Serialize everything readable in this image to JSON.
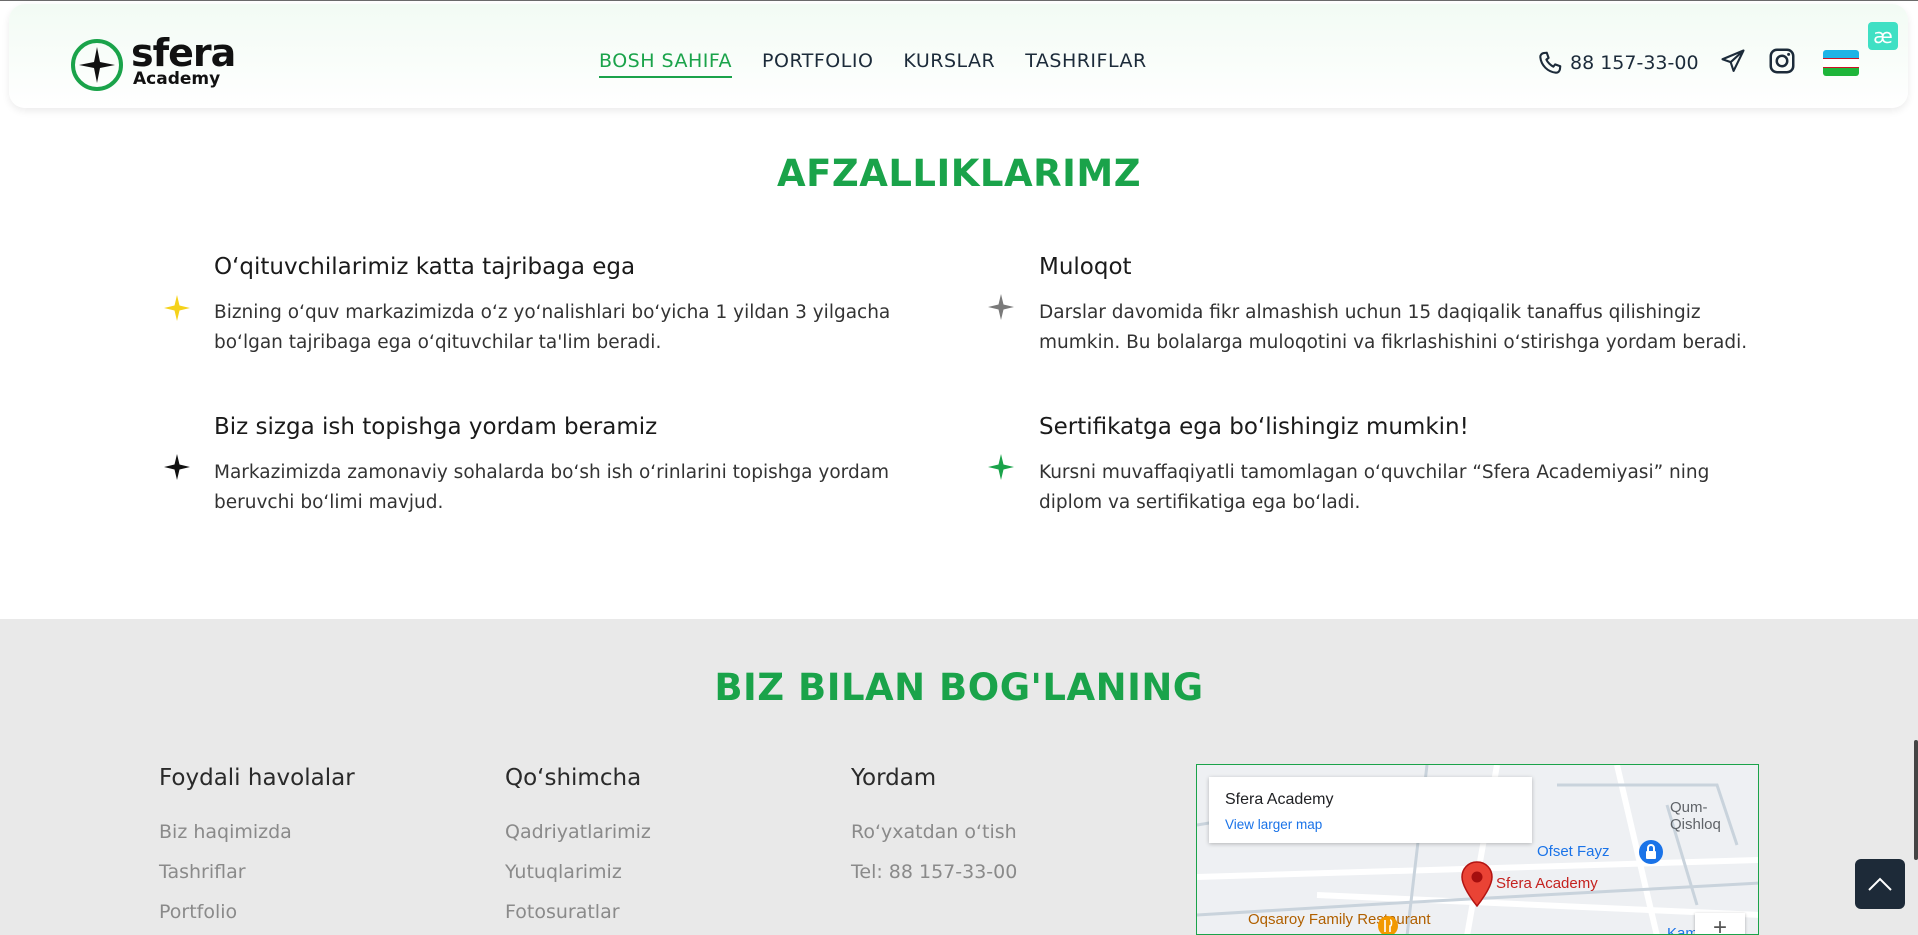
{
  "header": {
    "logo": {
      "name": "sfera",
      "sub": "Academy"
    },
    "nav": [
      {
        "label": "BOSH SAHIFA",
        "active": true
      },
      {
        "label": "PORTFOLIO",
        "active": false
      },
      {
        "label": "KURSLAR",
        "active": false
      },
      {
        "label": "TASHRIFLAR",
        "active": false
      }
    ],
    "phone": "88 157-33-00",
    "icons": [
      "phone-icon",
      "telegram-icon",
      "instagram-icon",
      "uzbekistan-flag-icon"
    ],
    "extension_badge": "æ"
  },
  "advantages": {
    "title": "AFZALLIKLARIMZ",
    "items": [
      {
        "title": "O‘qituvchilarimiz katta tajribaga ega",
        "text": "Bizning o‘quv markazimizda o‘z yo‘nalishlari bo‘yicha 1 yildan 3 yilgacha bo‘lgan tajribaga ega o‘qituvchilar ta'lim beradi.",
        "star_color": "#f5d21a"
      },
      {
        "title": "Muloqot",
        "text": "Darslar davomida fikr almashish uchun 15 daqiqalik tanaffus qilishingiz mumkin. Bu bolalarga muloqotini va fikrlashishini o‘stirishga yordam beradi.",
        "star_color": "#7a7a7a"
      },
      {
        "title": "Biz sizga ish topishga yordam beramiz",
        "text": "Markazimizda zamonaviy sohalarda bo‘sh ish o‘rinlarini topishga yordam beruvchi bo‘limi mavjud.",
        "star_color": "#111111"
      },
      {
        "title": "Sertifikatga ega bo‘lishingiz mumkin!",
        "text": "Kursni muvaffaqiyatli tamomlagan o‘quvchilar “Sfera Academiyasi” ning diplom va sertifikatiga ega bo‘ladi.",
        "star_color": "#1aa34a"
      }
    ]
  },
  "contact": {
    "title": "BIZ BILAN BOG'LANING",
    "columns": [
      {
        "heading": "Foydali havolalar",
        "links": [
          "Biz haqimizda",
          "Tashriflar",
          "Portfolio"
        ]
      },
      {
        "heading": "Qo‘shimcha",
        "links": [
          "Qadriyatlarimiz",
          "Yutuqlarimiz",
          "Fotosuratlar"
        ]
      },
      {
        "heading": "Yordam",
        "links": [
          "Ro‘yxatdan o‘tish",
          "Tel: 88 157-33-00"
        ]
      }
    ],
    "map": {
      "place": "Sfera Academy",
      "link": "View larger map",
      "labels": [
        "Qum-Qishloq",
        "Ofset Fayz",
        "Sfera Academy",
        "Oqsaroy Family Restaurant",
        "Kam"
      ],
      "zoom_in": "+"
    }
  },
  "colors": {
    "accent": "#1aa34a",
    "footer_bg": "#e9e9e9",
    "to_top_bg": "#1d2a38"
  }
}
